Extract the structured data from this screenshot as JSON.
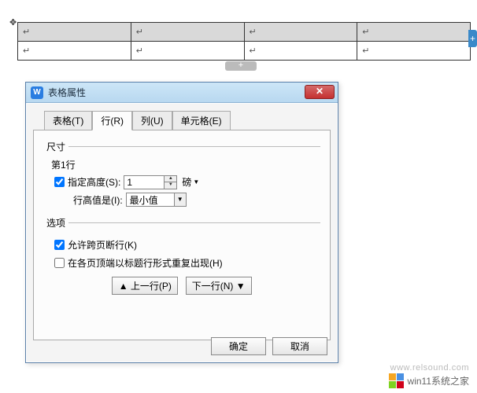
{
  "dialog": {
    "title": "表格属性",
    "tabs": {
      "table": "表格(T)",
      "row": "行(R)",
      "column": "列(U)",
      "cell": "单元格(E)"
    },
    "size": {
      "legend": "尺寸",
      "row_indicator": "第1行",
      "specify_height_label": "指定高度(S):",
      "height_value": "1",
      "unit": "磅",
      "row_height_is_label": "行高值是(I):",
      "row_height_is_value": "最小值"
    },
    "options": {
      "legend": "选项",
      "allow_break": "允许跨页断行(K)",
      "repeat_header": "在各页顶端以标题行形式重复出现(H)"
    },
    "nav": {
      "prev": "▲ 上一行(P)",
      "next": "下一行(N) ▼"
    },
    "footer": {
      "ok": "确定",
      "cancel": "取消"
    }
  },
  "cell_marker": "↵",
  "watermarks": {
    "site1": "win11系统之家",
    "site2": "www.relsound.com"
  },
  "colors": {
    "accent": "#2a7de1",
    "close": "#c53030"
  }
}
